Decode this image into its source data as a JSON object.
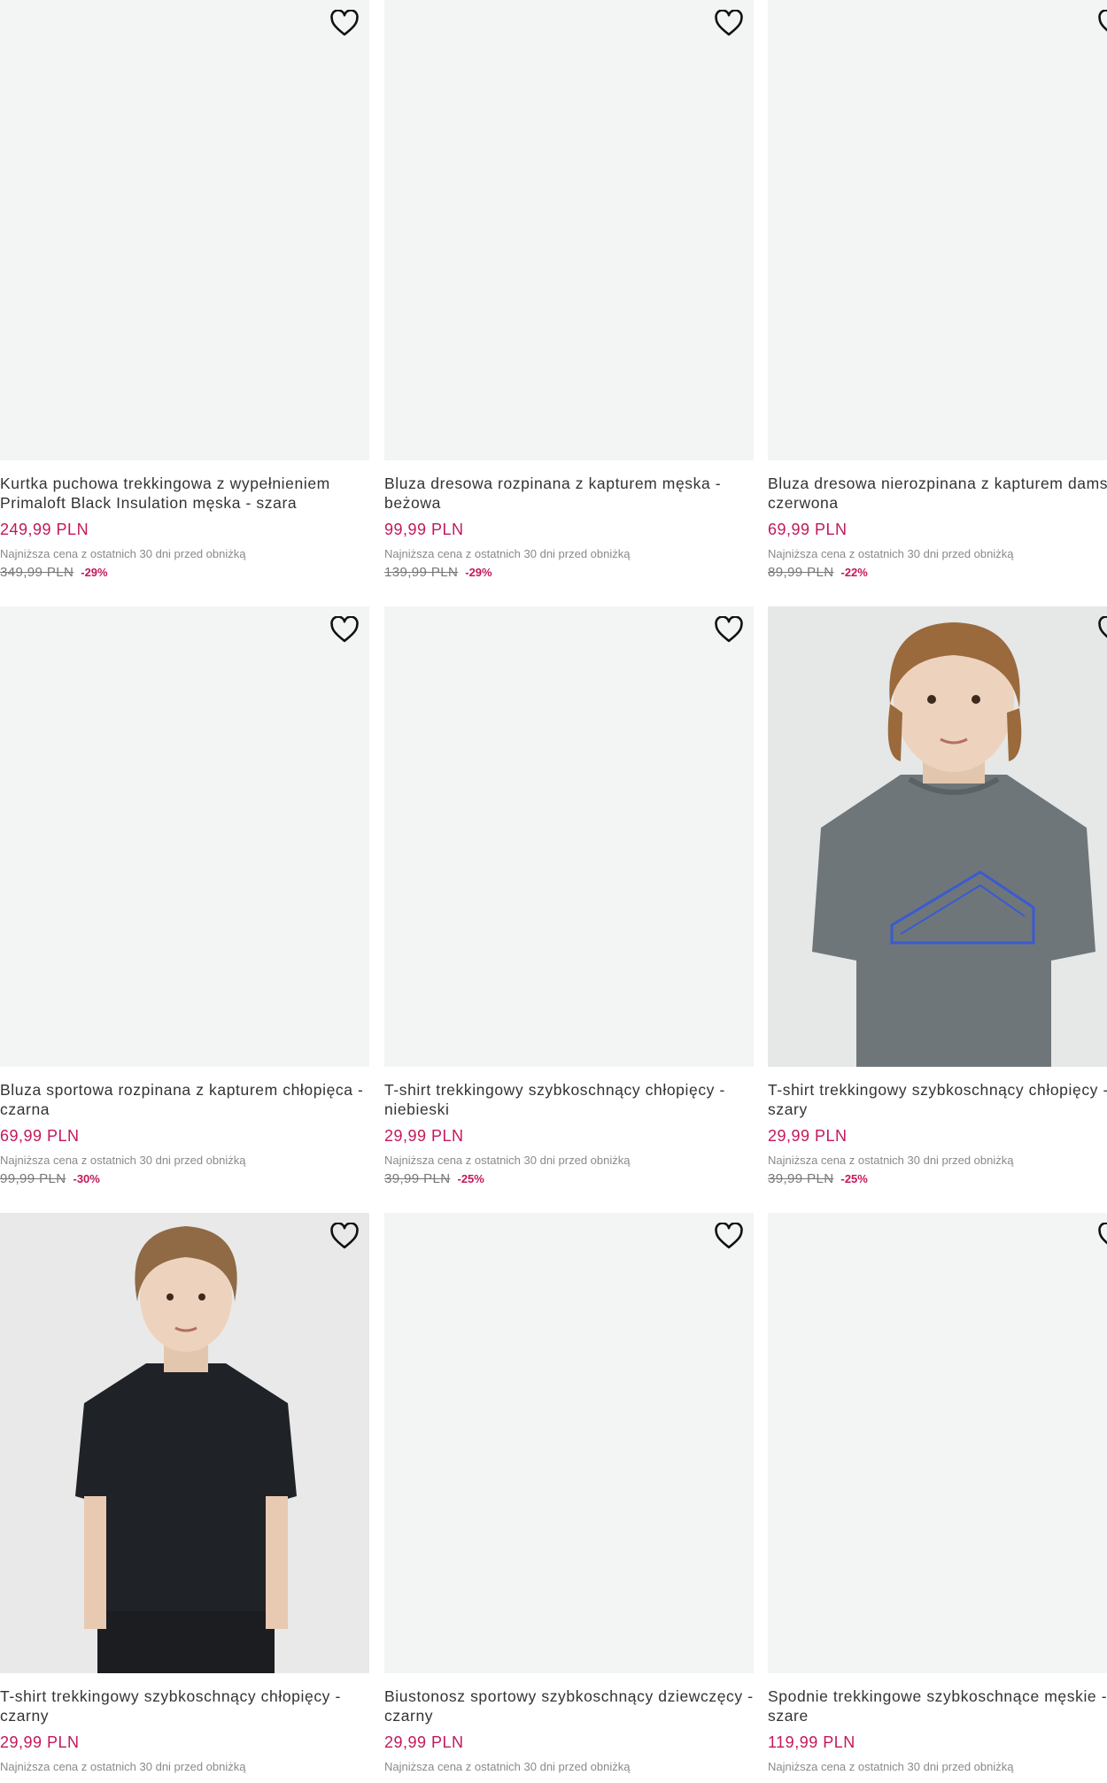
{
  "colors": {
    "accent_price": "#c2185b",
    "image_bg": "#f3f4f4"
  },
  "icons": {
    "favorite": "heart-outline-icon"
  },
  "products": [
    {
      "title": "Kurtka puchowa trekkingowa z wypełnieniem Primaloft Black Insulation męska - szara",
      "price": "249,99 PLN",
      "lowest_note": "Najniższa cena z ostatnich 30 dni przed obniżką",
      "old_price": "349,99 PLN",
      "discount": "-29%"
    },
    {
      "title": "Bluza dresowa rozpinana z kapturem męska - beżowa",
      "price": "99,99 PLN",
      "lowest_note": "Najniższa cena z ostatnich 30 dni przed obniżką",
      "old_price": "139,99 PLN",
      "discount": "-29%"
    },
    {
      "title": "Bluza dresowa nierozpinana z kapturem damska - czerwona",
      "price": "69,99 PLN",
      "lowest_note": "Najniższa cena z ostatnich 30 dni przed obniżką",
      "old_price": "89,99 PLN",
      "discount": "-22%"
    },
    {
      "title": "Bluza sportowa rozpinana z kapturem chłopięca - czarna",
      "price": "69,99 PLN",
      "lowest_note": "Najniższa cena z ostatnich 30 dni przed obniżką",
      "old_price": "99,99 PLN",
      "discount": "-30%"
    },
    {
      "title": "T-shirt trekkingowy szybkoschnący chłopięcy - niebieski",
      "price": "29,99 PLN",
      "lowest_note": "Najniższa cena z ostatnich 30 dni przed obniżką",
      "old_price": "39,99 PLN",
      "discount": "-25%"
    },
    {
      "title": "T-shirt trekkingowy szybkoschnący chłopięcy - szary",
      "price": "29,99 PLN",
      "lowest_note": "Najniższa cena z ostatnich 30 dni przed obniżką",
      "old_price": "39,99 PLN",
      "discount": "-25%"
    },
    {
      "title": "T-shirt trekkingowy szybkoschnący chłopięcy - czarny",
      "price": "29,99 PLN",
      "lowest_note": "Najniższa cena z ostatnich 30 dni przed obniżką",
      "old_price": "",
      "discount": ""
    },
    {
      "title": "Biustonosz sportowy szybkoschnący dziewczęcy - czarny",
      "price": "29,99 PLN",
      "lowest_note": "Najniższa cena z ostatnich 30 dni przed obniżką",
      "old_price": "",
      "discount": ""
    },
    {
      "title": "Spodnie trekkingowe szybkoschnące męskie - szare",
      "price": "119,99 PLN",
      "lowest_note": "Najniższa cena z ostatnich 30 dni przed obniżką",
      "old_price": "",
      "discount": ""
    }
  ]
}
